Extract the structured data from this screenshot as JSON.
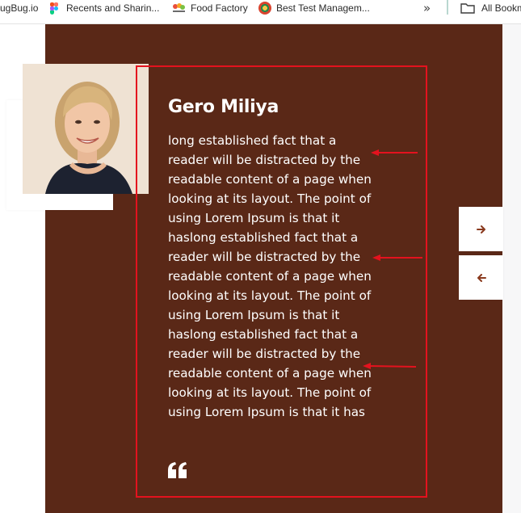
{
  "bookmarks_bar": {
    "items": [
      {
        "label": "ugBug.io"
      },
      {
        "label": "Recents and Sharin..."
      },
      {
        "label": "Food Factory"
      },
      {
        "label": "Best Test Managem..."
      }
    ],
    "overflow_label": "»",
    "all_bookmarks_label": "All Bookm"
  },
  "testimonial": {
    "name": "Gero Miliya",
    "text": "long established fact that a reader will be distracted by the readable content of a page when looking at its layout. The point of using Lorem Ipsum is that it haslong established fact that a reader will be distracted by the readable content of a page when looking at its layout. The point of using Lorem Ipsum is that it haslong established fact that a reader will be distracted by the readable content of a page when looking at its layout. The point of using Lorem Ipsum is that it has",
    "quote_icon": "quote-icon"
  },
  "navigation": {
    "next_icon": "arrow-right-icon",
    "prev_icon": "arrow-left-icon"
  },
  "colors": {
    "panel_background": "#5a2817",
    "annotation_red": "#e4121e",
    "text": "#ffffff",
    "arrow_accent": "#8a3a1e"
  }
}
